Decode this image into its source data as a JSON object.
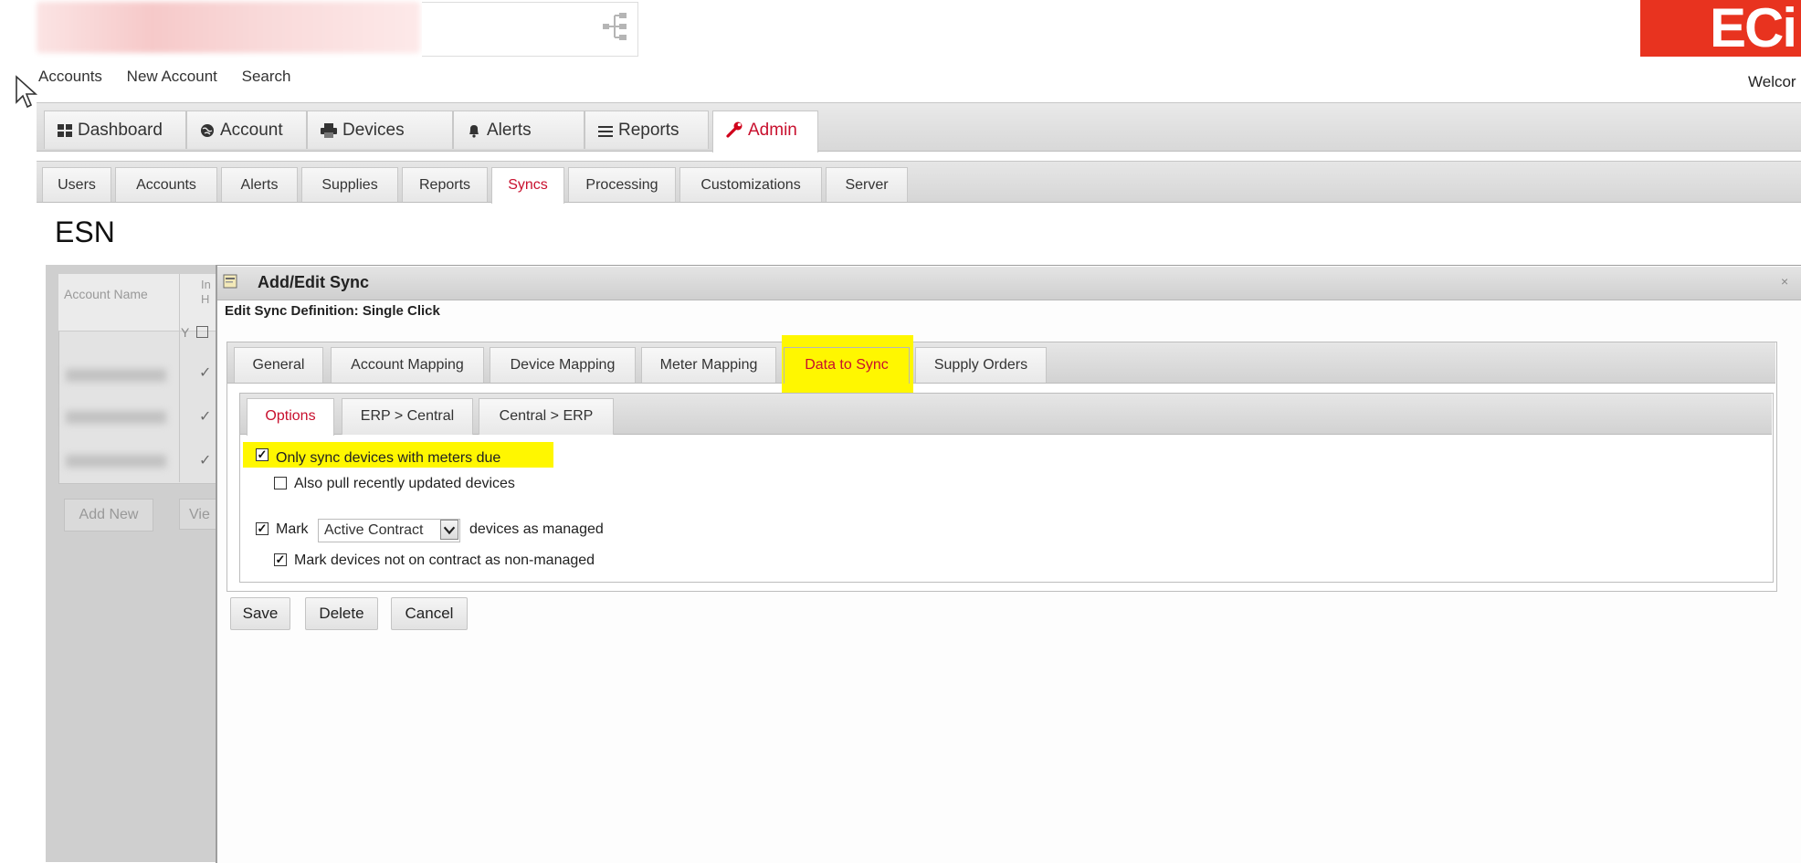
{
  "header": {
    "org_name_blurred": "",
    "logo_text": "ECi",
    "welcome_text": "Welcor",
    "colors": {
      "brand": "#e8331f",
      "active_tab": "#c8102e",
      "highlight": "#fff700"
    }
  },
  "top_nav": {
    "items": [
      "Accounts",
      "New Account",
      "Search"
    ]
  },
  "main_tabs": [
    {
      "label": "Dashboard",
      "icon": "grid-icon"
    },
    {
      "label": "Account",
      "icon": "globe-icon"
    },
    {
      "label": "Devices",
      "icon": "printer-icon"
    },
    {
      "label": "Alerts",
      "icon": "bell-icon"
    },
    {
      "label": "Reports",
      "icon": "list-icon"
    },
    {
      "label": "Admin",
      "icon": "wrench-icon",
      "active": true
    }
  ],
  "sub_tabs": [
    {
      "label": "Users"
    },
    {
      "label": "Accounts"
    },
    {
      "label": "Alerts"
    },
    {
      "label": "Supplies"
    },
    {
      "label": "Reports"
    },
    {
      "label": "Syncs",
      "active": true
    },
    {
      "label": "Processing"
    },
    {
      "label": "Customizations"
    },
    {
      "label": "Server"
    }
  ],
  "page_title": "ESN",
  "background_list": {
    "col_account_name": "Account Name",
    "col_in_line1": "In",
    "col_in_line2": "H",
    "filter_glyph": "Y",
    "check_glyph": "✓",
    "add_new_label": "Add New",
    "view_label": "Vie"
  },
  "dialog": {
    "title": "Add/Edit Sync",
    "subtitle": "Edit Sync Definition: Single Click",
    "close_glyph": "×",
    "tabs": [
      {
        "label": "General"
      },
      {
        "label": "Account Mapping"
      },
      {
        "label": "Device Mapping"
      },
      {
        "label": "Meter Mapping"
      },
      {
        "label": "Data to Sync",
        "active": true
      },
      {
        "label": "Supply Orders"
      }
    ],
    "inner_tabs": [
      {
        "label": "Options",
        "active": true
      },
      {
        "label": "ERP > Central"
      },
      {
        "label": "Central > ERP"
      }
    ],
    "options": {
      "only_sync_meters_due": {
        "label": "Only sync devices with meters due",
        "checked": true
      },
      "also_pull_recent": {
        "label": "Also pull recently updated devices",
        "checked": false
      },
      "mark_prefix": {
        "label": "Mark",
        "checked": true
      },
      "contract_select": {
        "value": "Active Contract"
      },
      "mark_suffix": "devices as managed",
      "mark_non_contract": {
        "label": "Mark devices not on contract as non-managed",
        "checked": true
      }
    },
    "buttons": {
      "save": "Save",
      "delete": "Delete",
      "cancel": "Cancel"
    }
  }
}
